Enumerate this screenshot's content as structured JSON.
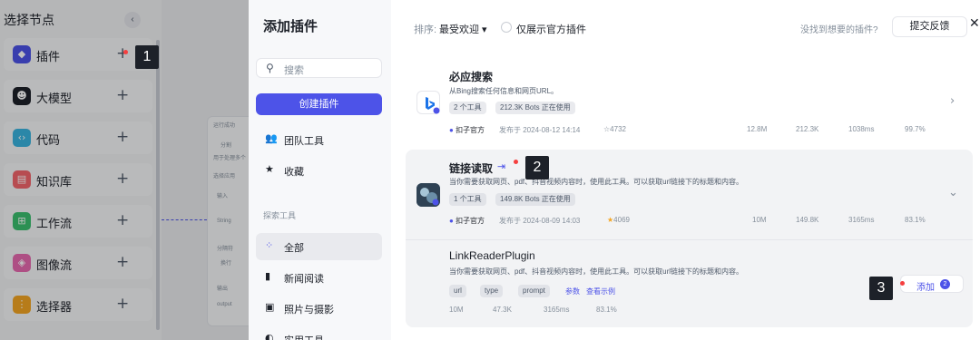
{
  "nodes_panel": {
    "title": "选择节点",
    "collapse_icon": "chevron-left-icon",
    "items": [
      {
        "label": "插件",
        "icon": "cube-icon",
        "color": "#4d53e8"
      },
      {
        "label": "大模型",
        "icon": "llm-icon",
        "color": "#1d2129"
      },
      {
        "label": "代码",
        "icon": "code-icon",
        "color": "#3ab4e0"
      },
      {
        "label": "知识库",
        "icon": "knowledge-icon",
        "color": "#f5666d"
      },
      {
        "label": "工作流",
        "icon": "workflow-icon",
        "color": "#3bc16f"
      },
      {
        "label": "图像流",
        "icon": "imageflow-icon",
        "color": "#e86ab0"
      },
      {
        "label": "选择器",
        "icon": "selector-icon",
        "color": "#f5a623"
      }
    ]
  },
  "canvas": {
    "lines": [
      "运行成功",
      "分割",
      "用于处理多个",
      "选择应用",
      "输入",
      "String",
      "分隔符",
      "换行",
      "输出",
      "output"
    ]
  },
  "plugin_panel": {
    "title": "添加插件",
    "search_placeholder": "搜索",
    "create_label": "创建插件",
    "top_items": [
      {
        "label": "团队工具",
        "icon": "team-icon"
      },
      {
        "label": "收藏",
        "icon": "star-icon"
      }
    ],
    "section_title": "探索工具",
    "explore_items": [
      {
        "label": "全部",
        "icon": "grid-icon",
        "active": true
      },
      {
        "label": "新闻阅读",
        "icon": "news-icon",
        "active": false
      },
      {
        "label": "照片与摄影",
        "icon": "photo-icon",
        "active": false
      },
      {
        "label": "实用工具",
        "icon": "tool-icon",
        "active": false
      }
    ]
  },
  "toolbar": {
    "sort_label": "排序:",
    "sort_value": "最受欢迎 ▾",
    "official_only_label": "仅展示官方插件",
    "not_found_text": "没找到想要的插件?",
    "feedback_label": "提交反馈",
    "close_icon": "close-icon"
  },
  "plugins": [
    {
      "name": "必应搜索",
      "icon": "bing-icon",
      "desc": "从Bing搜索任何信息和网页URL。",
      "tags": [
        "2 个工具",
        "212.3K Bots 正在使用"
      ],
      "publisher": "扣子官方",
      "published": "发布于 2024-08-12 14:14",
      "favorites": "4732",
      "stats": [
        "12.8M",
        "212.3K",
        "1038ms",
        "99.7%"
      ]
    },
    {
      "name": "链接读取",
      "icon": "link-reader-icon",
      "desc": "当你需要获取网页、pdf、抖音视频内容时，使用此工具。可以获取url链接下的标题和内容。",
      "tags": [
        "1 个工具",
        "149.8K Bots 正在使用"
      ],
      "publisher": "扣子官方",
      "published": "发布于 2024-08-09 14:03",
      "favorites": "4069",
      "stats": [
        "10M",
        "149.8K",
        "3165ms",
        "83.1%"
      ]
    }
  ],
  "tool": {
    "name": "LinkReaderPlugin",
    "desc": "当你需要获取网页、pdf、抖音视频内容时，使用此工具。可以获取url链接下的标题和内容。",
    "params": [
      "url",
      "type",
      "prompt"
    ],
    "params_link": "参数",
    "example_link": "查看示例",
    "stats": [
      "10M",
      "47.3K",
      "3165ms",
      "83.1%"
    ],
    "add_label": "添加",
    "add_count": "2"
  },
  "annotations": [
    "1",
    "2",
    "3"
  ]
}
